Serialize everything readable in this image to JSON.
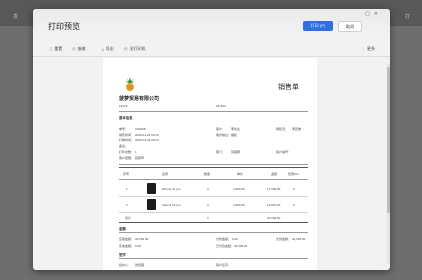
{
  "background": {
    "left_text": "发",
    "right_text": "打"
  },
  "dialog": {
    "title": "打印预览",
    "print_button": "打印 (P)",
    "cancel_button": "取消",
    "toolbar": {
      "items": [
        "重置",
        "放缩",
        "导出",
        "全打印机"
      ],
      "more": "更多"
    }
  },
  "document": {
    "title": "销售单",
    "company": "菠萝贸易有限公司",
    "company_sub": "12373",
    "company_sub2": "ZF-444",
    "section_basic": "基本信息",
    "info": [
      {
        "k": "单号：",
        "v": "XZ0438"
      },
      {
        "k": "销售时间：",
        "v": "2020-01-26 09:14"
      },
      {
        "k": "打单时间：",
        "v": "2020-01-26 09:14"
      },
      {
        "k": "备注：",
        "v": ""
      },
      {
        "k": "打印次数：",
        "v": "1"
      },
      {
        "k": "客户经理：",
        "v": "顾客甲"
      }
    ],
    "info_mid": [
      {
        "k": "客户：",
        "v": "李先生"
      },
      {
        "k": "收货地址：",
        "v": "福建"
      },
      {
        "k": "部门：",
        "v": "营销部"
      }
    ],
    "info_right": [
      {
        "k": "销售员：",
        "v": "李四维"
      },
      {
        "k": "客户编号：",
        "v": ""
      }
    ],
    "table": {
      "headers": [
        "序号",
        "名称",
        "数量",
        "单价",
        "金额",
        "优惠(%)"
      ],
      "rows": [
        {
          "no": "1",
          "name": "iPhone 11 pro",
          "qty": "3",
          "price": "4,999.00",
          "amount": "17,999.00",
          "disc": "5"
        },
        {
          "no": "2",
          "name": "Xiaomi 10 pro",
          "qty": "3",
          "price": "4,999.00",
          "amount": "14,997.00",
          "disc": "5"
        }
      ],
      "total": {
        "label": "合计",
        "qty": "3",
        "amount": "34,693.00"
      }
    },
    "section_amount": "金额",
    "amount": [
      {
        "k": "应收金额：",
        "v": "34,693.00"
      },
      {
        "k": "实收金额：",
        "v": "0.00"
      },
      {
        "k": "欠款金额：",
        "v": "34,693.00"
      }
    ],
    "amount2": [
      {
        "k": "付款金额：",
        "v": "0.00"
      },
      {
        "k": "已付款金额：",
        "v": "34,693.00"
      }
    ],
    "section_sign": "签字",
    "sign": [
      {
        "k": "经办人：",
        "v": "张经理"
      },
      {
        "k": "客户签字：",
        "v": ""
      }
    ]
  }
}
